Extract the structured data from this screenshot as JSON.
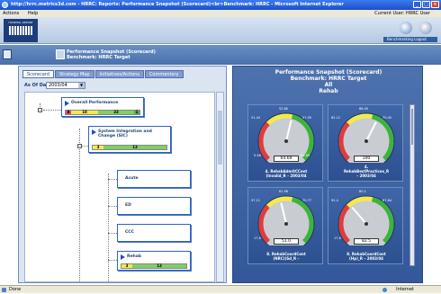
{
  "window": {
    "title": "http://hrrc.metrics3d.com - HRRC: Reports: Performance Snapshot (Scorecard)<br>Benchmark: HRRC  -  Microsoft Internet Explorer",
    "minimize": "_",
    "maximize": "□",
    "close": "×"
  },
  "menu": {
    "items": [
      "Actions",
      "Help"
    ],
    "current_user": "Current User: HRRC User"
  },
  "banner": {
    "logo_text": "HOSPITAL REPORT",
    "links": "Benchmarking   Logout"
  },
  "report": {
    "title_line1": "Performance Snapshot (Scorecard)",
    "title_line2": "Benchmark: HRRC Target"
  },
  "tabs": [
    "Scorecard",
    "Strategy Map",
    "Initiatives/Actions",
    "Commentary"
  ],
  "as_of": {
    "label": "As Of Date:",
    "value": "2003/04"
  },
  "tree": {
    "nodes": [
      {
        "label": "Overall Performance",
        "scores": [
          "8",
          "18",
          "33",
          "1"
        ]
      },
      {
        "label": "System Integration and Change (SIC)",
        "scores": [
          "3",
          "13"
        ]
      },
      {
        "label": "Acute"
      },
      {
        "label": "ED"
      },
      {
        "label": "CCC"
      },
      {
        "label": "Rehab",
        "scores": [
          "3",
          "13"
        ]
      }
    ]
  },
  "right_panel": {
    "title_line1": "Performance Snapshot (Scorecard)",
    "title_line2": "Benchmark: HRRC Target",
    "title_line3": "All",
    "title_line4": "Rehab"
  },
  "gauges": [
    {
      "value": "64.69",
      "label_line1": "4. RehabAdmitCCent",
      "label_line2": "(Invalid_R – 2003/04",
      "level": 0.55,
      "ticks": {
        "left": "51.44",
        "top": "52.80",
        "right": "57.05",
        "bottom_left": "0.48",
        "bottom_right": "61.69"
      }
    },
    {
      "value": "100",
      "label_line1": "4.",
      "label_line2": "RehabBestPractices_R",
      "label_line3": "– 2003/04",
      "level": 0.6,
      "ticks": {
        "left": "62.12",
        "top": "68.45",
        "right": "70.45",
        "bottom_left": "",
        "bottom_right": ""
      }
    },
    {
      "value": "51.0",
      "label_line1": "8. RehabCoordCont",
      "label_line2": "(NRC)(Sd_R –",
      "level": 0.45,
      "ticks": {
        "left": "57.11",
        "top": "61.96",
        "right": "70.77",
        "bottom_left": "17.6",
        "bottom_right": ""
      }
    },
    {
      "value": "82.5",
      "label_line1": "8. RehabCoordCont",
      "label_line2": "(Hp)_R – 2003/04",
      "level": 0.35,
      "ticks": {
        "left": "92.4",
        "top": "80.1",
        "right": "67.84",
        "bottom_left": "17.6",
        "bottom_right": ""
      }
    }
  ],
  "status": {
    "left": "Done",
    "right": "Internet"
  },
  "colors": {
    "accent": "#2d63c8",
    "panel": "#3f66a8",
    "good": "#3cb43c",
    "warn": "#f3ea4a",
    "bad": "#e03c3c"
  }
}
